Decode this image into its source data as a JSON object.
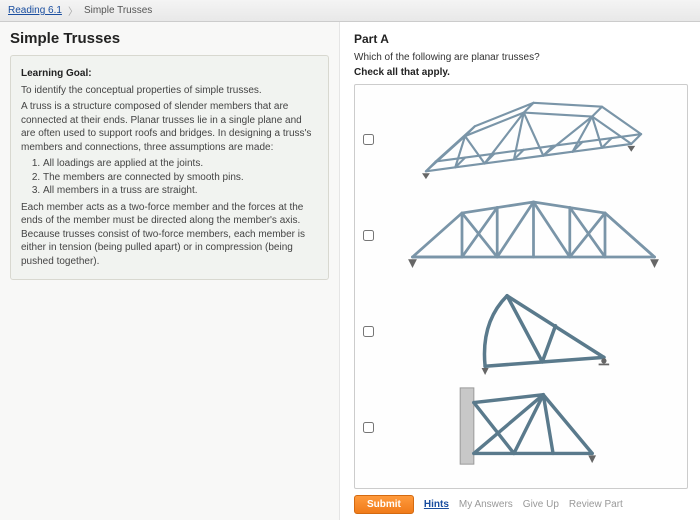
{
  "breadcrumb": {
    "link_label": "Reading 6.1",
    "current_label": "Simple Trusses"
  },
  "page_title": "Simple Trusses",
  "learning_goal": {
    "heading": "Learning Goal:",
    "intro": "To identify the conceptual properties of simple trusses.",
    "para1": "A truss is a structure composed of slender members that are connected at their ends. Planar trusses lie in a single plane and are often used to support roofs and bridges. In designing a truss's members and connections, three assumptions are made:",
    "assumption1": "All loadings are applied at the joints.",
    "assumption2": "The members are connected by smooth pins.",
    "assumption3": "All members in a truss are straight.",
    "para2": "Each member acts as a two-force member and the forces at the ends of the member must be directed along the member's axis. Because trusses consist of two-force members, each member is either in tension (being pulled apart) or in compression (being pushed together)."
  },
  "partA": {
    "label": "Part A",
    "question": "Which of the following are planar trusses?",
    "instruction": "Check all that apply.",
    "options": [
      {
        "id": "opt1"
      },
      {
        "id": "opt2"
      },
      {
        "id": "opt3"
      },
      {
        "id": "opt4"
      }
    ]
  },
  "actions": {
    "submit": "Submit",
    "hints": "Hints",
    "my_answers": "My Answers",
    "give_up": "Give Up",
    "review_part": "Review Part"
  }
}
